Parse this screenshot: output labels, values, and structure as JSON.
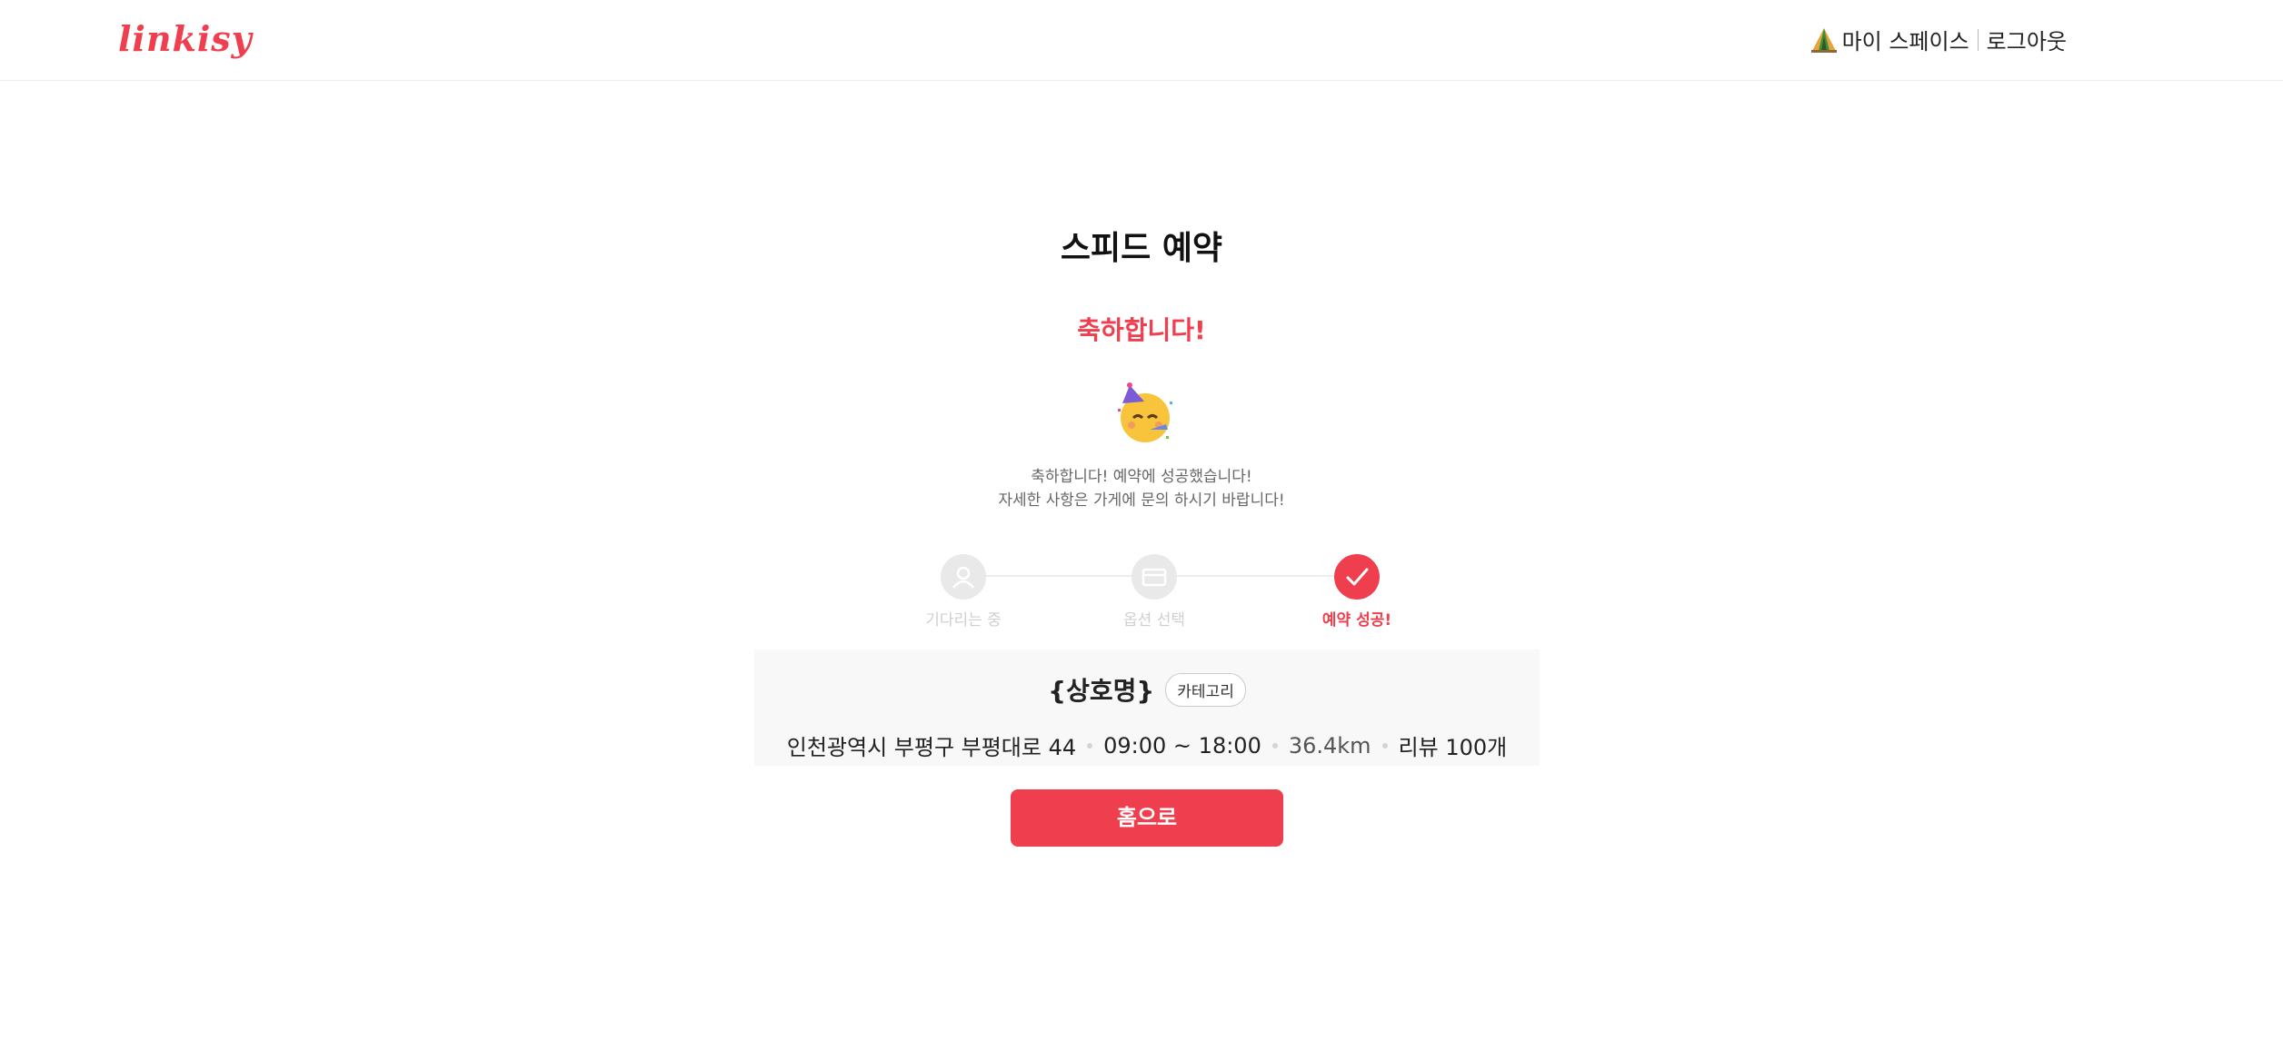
{
  "header": {
    "logo_text": "linkisy",
    "my_space_label": "마이 스페이스",
    "logout_label": "로그아웃",
    "my_space_icon": "tent-icon"
  },
  "main": {
    "title": "스피드 예약",
    "congrats": "축하합니다!",
    "emoji_icon": "party-face-icon",
    "desc_line1": "축하합니다! 예약에 성공했습니다!",
    "desc_line2": "자세한 사항은 가게에 문의 하시기 바랍니다!"
  },
  "steps": [
    {
      "label": "기다리는 중",
      "icon": "user-icon",
      "active": false
    },
    {
      "label": "옵션 선택",
      "icon": "card-icon",
      "active": false
    },
    {
      "label": "예약 성공!",
      "icon": "check-icon",
      "active": true
    }
  ],
  "shop": {
    "name": "{상호명}",
    "category": "카테고리",
    "address": "인천광역시 부평구 부평대로 44",
    "hours": "09:00 ~ 18:00",
    "distance": "36.4km",
    "reviews": "리뷰 100개"
  },
  "button": {
    "home_label": "홈으로"
  },
  "colors": {
    "accent": "#ef3e4d",
    "step_inactive": "#e9e9e9",
    "box_bg": "#f8f8f8"
  }
}
